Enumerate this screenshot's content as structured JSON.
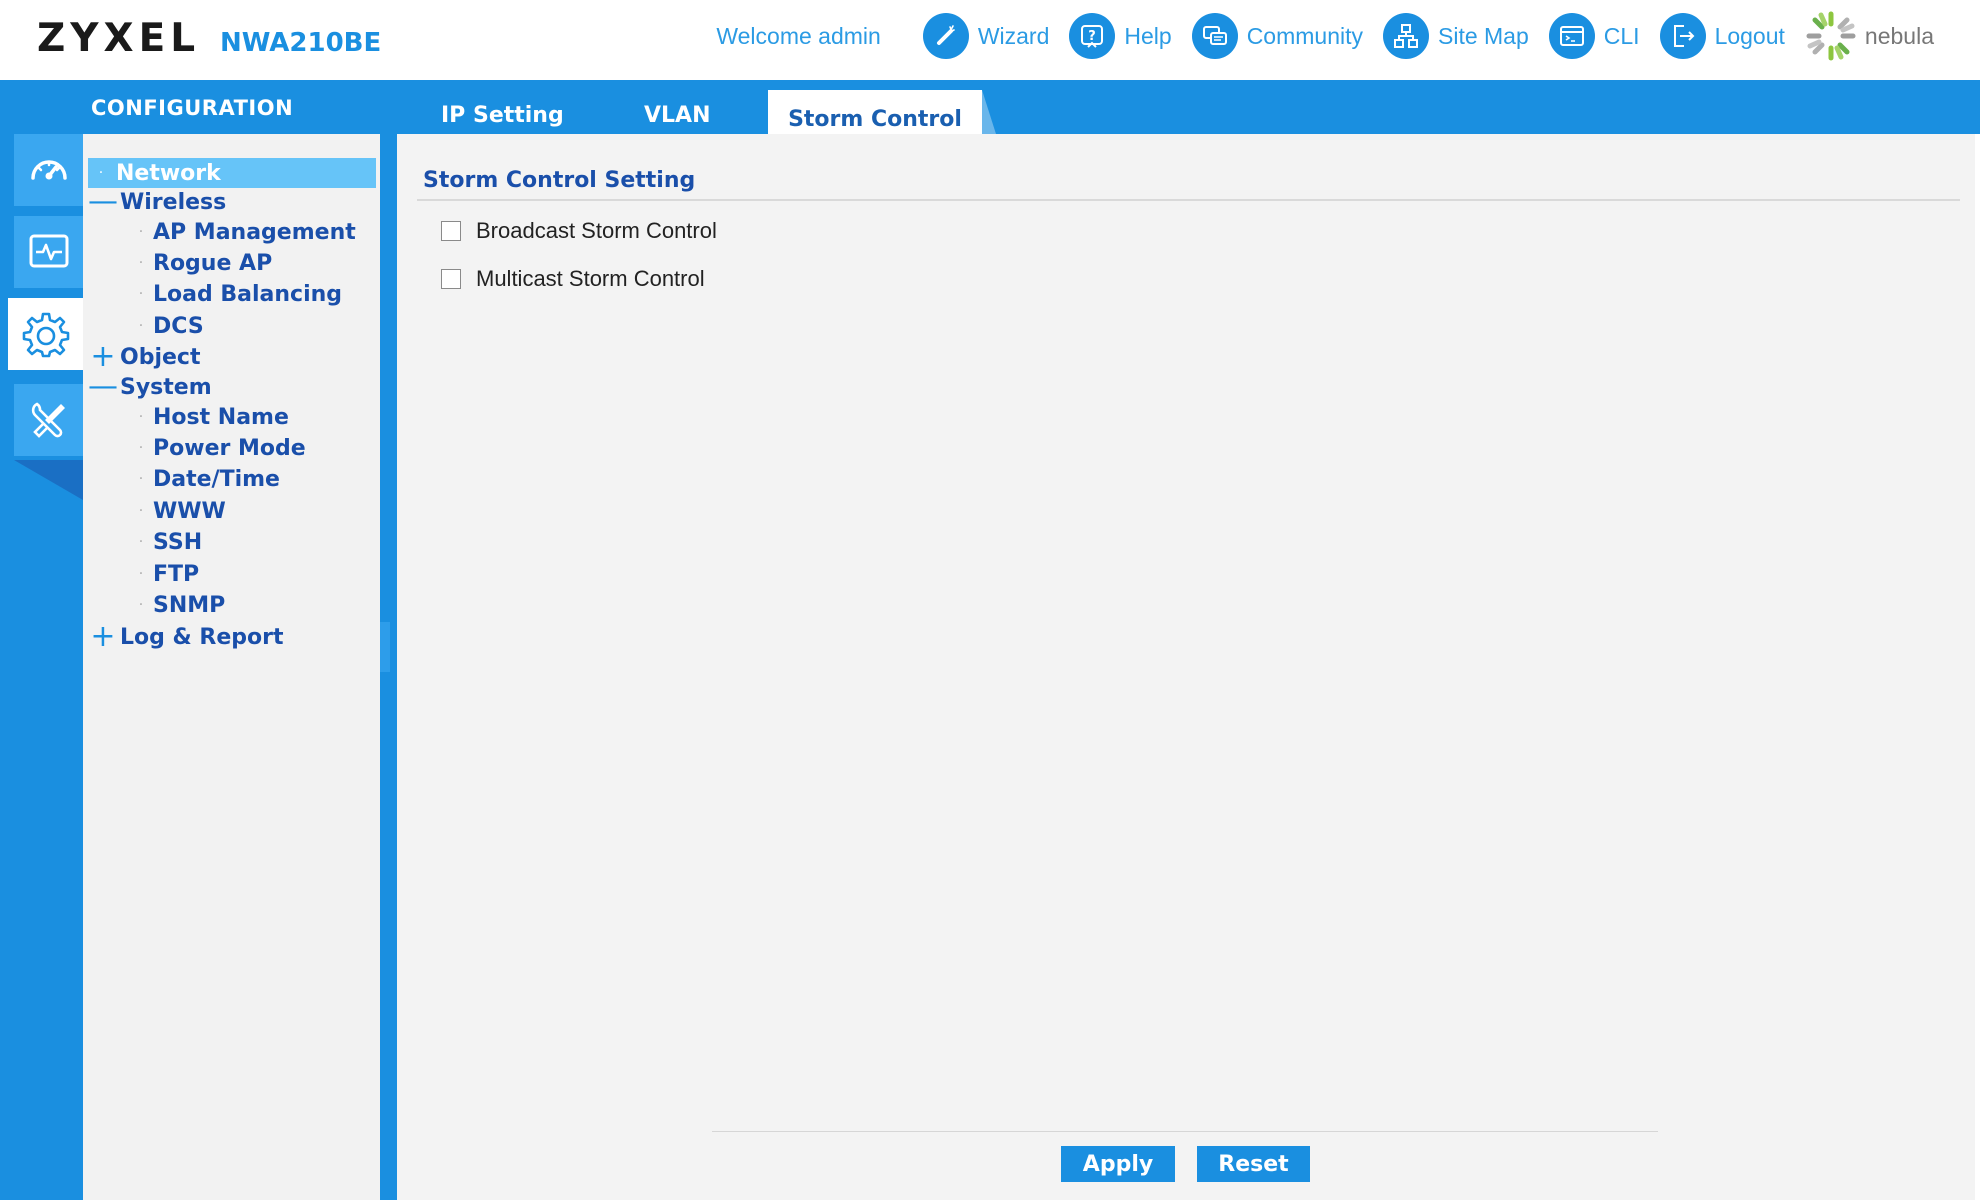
{
  "header": {
    "brand": "ZYXEL",
    "model": "NWA210BE",
    "welcome": "Welcome admin",
    "nav": [
      {
        "label": "Wizard",
        "icon": "wand-icon"
      },
      {
        "label": "Help",
        "icon": "help-icon"
      },
      {
        "label": "Community",
        "icon": "chat-icon"
      },
      {
        "label": "Site Map",
        "icon": "sitemap-icon"
      },
      {
        "label": "CLI",
        "icon": "cli-icon"
      },
      {
        "label": "Logout",
        "icon": "logout-icon"
      }
    ],
    "nebula": "nebula"
  },
  "top_bar": {
    "section_title": "CONFIGURATION",
    "tabs": [
      {
        "label": "IP Setting",
        "active": false
      },
      {
        "label": "VLAN",
        "active": false
      },
      {
        "label": "Storm Control",
        "active": true
      }
    ]
  },
  "rail": [
    {
      "icon": "dashboard-icon",
      "active": false
    },
    {
      "icon": "monitor-icon",
      "active": false
    },
    {
      "icon": "gear-icon",
      "active": true
    },
    {
      "icon": "tools-icon",
      "active": false
    }
  ],
  "tree": {
    "items": [
      {
        "label": "Network",
        "toggle": "·",
        "selected": true
      },
      {
        "label": "Wireless",
        "toggle": "—"
      },
      {
        "label": "AP Management",
        "toggle": "·"
      },
      {
        "label": "Rogue AP",
        "toggle": "·"
      },
      {
        "label": "Load Balancing",
        "toggle": "·"
      },
      {
        "label": "DCS",
        "toggle": "·"
      },
      {
        "label": "Object",
        "toggle": "+"
      },
      {
        "label": "System",
        "toggle": "—"
      },
      {
        "label": "Host Name",
        "toggle": "·"
      },
      {
        "label": "Power Mode",
        "toggle": "·"
      },
      {
        "label": "Date/Time",
        "toggle": "·"
      },
      {
        "label": "WWW",
        "toggle": "·"
      },
      {
        "label": "SSH",
        "toggle": "·"
      },
      {
        "label": "FTP",
        "toggle": "·"
      },
      {
        "label": "SNMP",
        "toggle": "·"
      },
      {
        "label": "Log & Report",
        "toggle": "+"
      }
    ]
  },
  "content": {
    "section_title": "Storm Control Setting",
    "options": [
      {
        "label": "Broadcast Storm Control",
        "checked": false
      },
      {
        "label": "Multicast Storm Control",
        "checked": false
      }
    ],
    "apply_label": "Apply",
    "reset_label": "Reset"
  },
  "colors": {
    "accent": "#1a8fe0",
    "tree_text": "#1a4faa",
    "selected": "#66c4f8"
  }
}
